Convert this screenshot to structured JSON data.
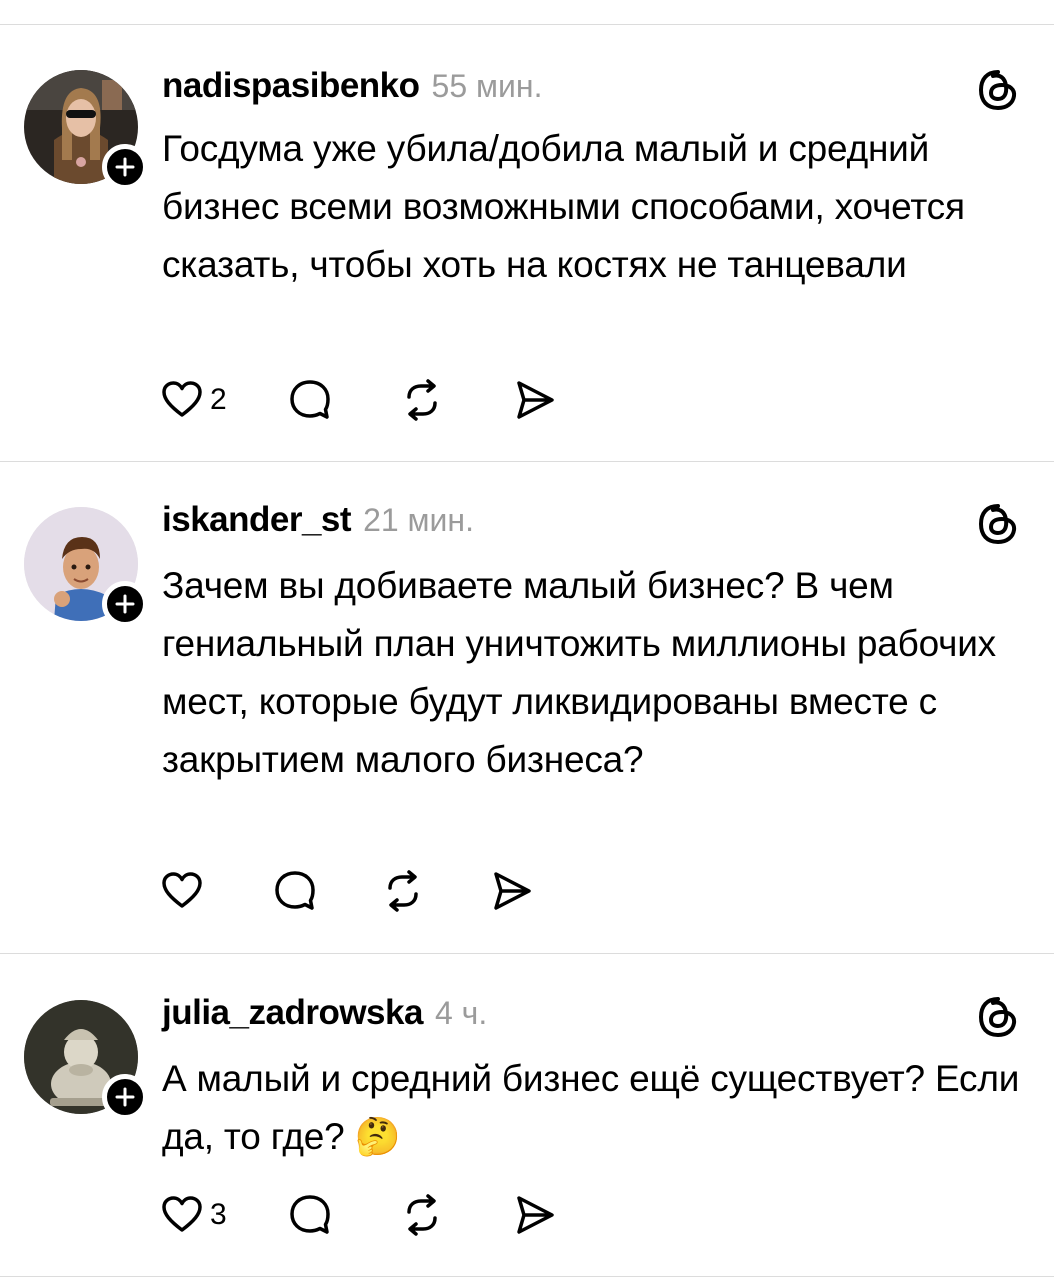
{
  "posts": [
    {
      "username": "nadispasibenko",
      "time": "55 мин.",
      "text": "Госдума уже убила/добила малый и средний бизнес всеми возможными способами, хочется сказать, чтобы хоть на костях не танцевали",
      "likes": "2"
    },
    {
      "username": "iskander_st",
      "time": "21 мин.",
      "text": "Зачем вы добиваете малый бизнес? В чем гениальный план уничтожить миллионы рабочих мест, которые будут ликвидированы вместе с закрытием малого бизнеса?",
      "likes": ""
    },
    {
      "username": "julia_zadrowska",
      "time": "4 ч.",
      "text": "А малый и средний бизнес ещё существует? Если да, то где? 🤔",
      "likes": "3"
    }
  ],
  "icons": {
    "like": "heart-icon",
    "reply": "comment-bubble-icon",
    "repost": "repost-arrows-icon",
    "share": "send-paper-plane-icon",
    "app": "threads-logo-icon",
    "follow": "plus-icon"
  }
}
